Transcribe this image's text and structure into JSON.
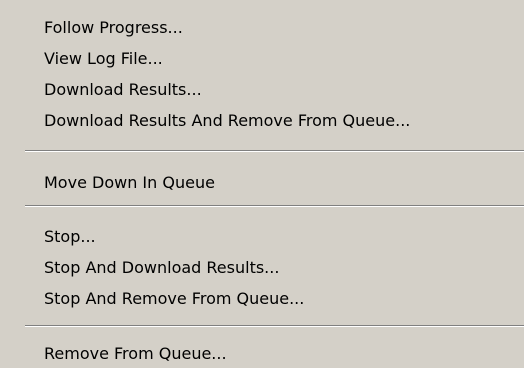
{
  "menu": {
    "items": [
      {
        "label": "Follow Progress..."
      },
      {
        "label": "View Log File..."
      },
      {
        "label": "Download Results..."
      },
      {
        "label": "Download Results And Remove From Queue..."
      },
      {
        "label": "Move Down In Queue"
      },
      {
        "label": "Stop..."
      },
      {
        "label": "Stop And Download Results..."
      },
      {
        "label": "Stop And Remove From Queue..."
      },
      {
        "label": "Remove From Queue..."
      }
    ]
  }
}
